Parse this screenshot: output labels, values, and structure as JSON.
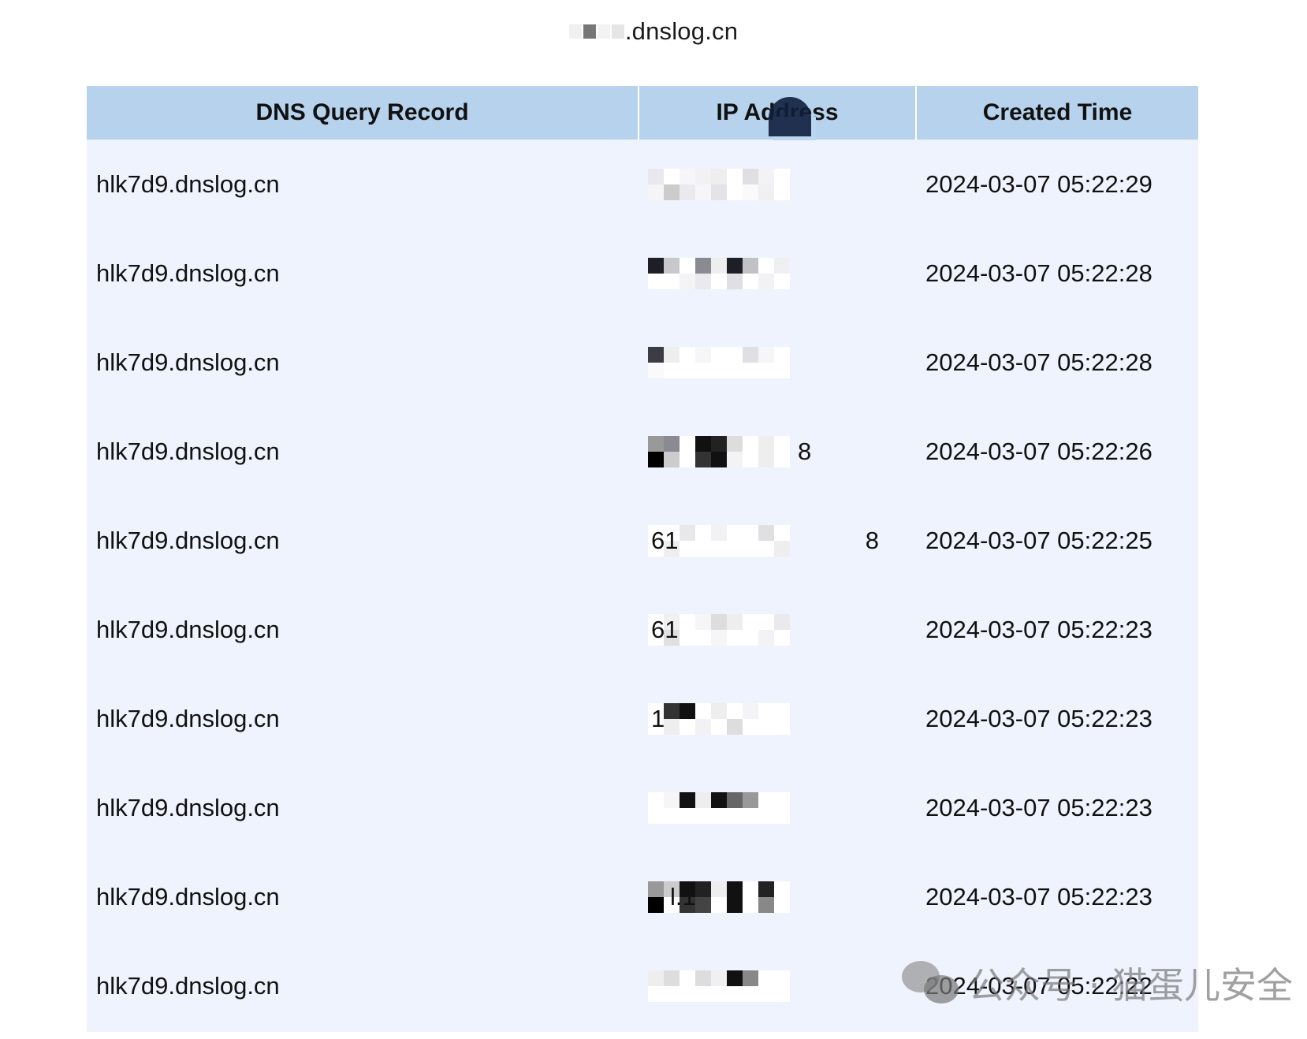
{
  "domain_title": ".dnslog.cn",
  "table": {
    "headers": [
      "DNS Query Record",
      "IP Address",
      "Created Time"
    ],
    "rows": [
      {
        "record": "hlk7d9.dnslog.cn",
        "ip_visible": "",
        "time": "2024-03-07 05:22:29"
      },
      {
        "record": "hlk7d9.dnslog.cn",
        "ip_visible": "",
        "time": "2024-03-07 05:22:28"
      },
      {
        "record": "hlk7d9.dnslog.cn",
        "ip_visible": "",
        "time": "2024-03-07 05:22:28"
      },
      {
        "record": "hlk7d9.dnslog.cn",
        "ip_visible": "8",
        "time": "2024-03-07 05:22:26"
      },
      {
        "record": "hlk7d9.dnslog.cn",
        "ip_visible": "61  8",
        "time": "2024-03-07 05:22:25"
      },
      {
        "record": "hlk7d9.dnslog.cn",
        "ip_visible": "61",
        "time": "2024-03-07 05:22:23"
      },
      {
        "record": "hlk7d9.dnslog.cn",
        "ip_visible": "1",
        "time": "2024-03-07 05:22:23"
      },
      {
        "record": "hlk7d9.dnslog.cn",
        "ip_visible": "",
        "time": "2024-03-07 05:22:23"
      },
      {
        "record": "hlk7d9.dnslog.cn",
        "ip_visible": "l.1",
        "time": "2024-03-07 05:22:23"
      },
      {
        "record": "hlk7d9.dnslog.cn",
        "ip_visible": "",
        "time": "2024-03-07 05:22:22"
      }
    ]
  },
  "watermark": {
    "icon": "wechat-icon",
    "text": "公众号 · 猫蛋儿安全"
  }
}
